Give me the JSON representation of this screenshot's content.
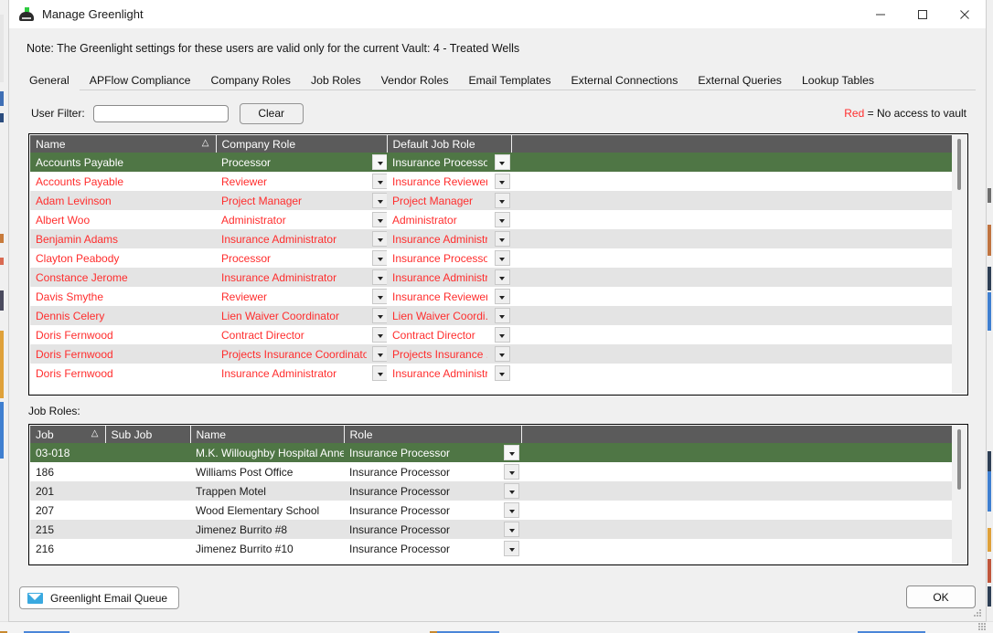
{
  "window": {
    "title": "Manage Greenlight",
    "icon": "greenlight-app-icon",
    "minimize": "—",
    "maximize": "□",
    "close": "✕"
  },
  "note": "Note:  The Greenlight settings for these users are valid only for the current Vault: 4 - Treated Wells",
  "tabs": [
    {
      "label": "General",
      "active": true
    },
    {
      "label": "APFlow Compliance",
      "active": false
    },
    {
      "label": "Company Roles",
      "active": false
    },
    {
      "label": "Job Roles",
      "active": false
    },
    {
      "label": "Vendor Roles",
      "active": false
    },
    {
      "label": "Email Templates",
      "active": false
    },
    {
      "label": "External Connections",
      "active": false
    },
    {
      "label": "External Queries",
      "active": false
    },
    {
      "label": "Lookup Tables",
      "active": false
    }
  ],
  "filter": {
    "label": "User Filter:",
    "value": "",
    "placeholder": "",
    "clear_label": "Clear"
  },
  "legend": {
    "keyword": "Red",
    "text": "= No access to vault",
    "color": "#ff2d2d"
  },
  "users_grid": {
    "columns": [
      {
        "label": "Name",
        "sort": "△"
      },
      {
        "label": "Company Role",
        "sort": ""
      },
      {
        "label": "Default Job Role",
        "sort": ""
      },
      {
        "label": "",
        "sort": ""
      }
    ],
    "rows": [
      {
        "name": "Accounts Payable",
        "company_role": "Processor",
        "default_job_role": "Insurance Processor",
        "selected": true,
        "no_access": false
      },
      {
        "name": "Accounts Payable",
        "company_role": "Reviewer",
        "default_job_role": "Insurance Reviewer",
        "selected": false,
        "no_access": true
      },
      {
        "name": "Adam Levinson",
        "company_role": "Project Manager",
        "default_job_role": "Project Manager",
        "selected": false,
        "no_access": true
      },
      {
        "name": "Albert Woo",
        "company_role": "Administrator",
        "default_job_role": "Administrator",
        "selected": false,
        "no_access": true
      },
      {
        "name": "Benjamin Adams",
        "company_role": "Insurance Administrator",
        "default_job_role": "Insurance Administr...",
        "selected": false,
        "no_access": true
      },
      {
        "name": "Clayton Peabody",
        "company_role": "Processor",
        "default_job_role": "Insurance Processor",
        "selected": false,
        "no_access": true
      },
      {
        "name": "Constance Jerome",
        "company_role": "Insurance Administrator",
        "default_job_role": "Insurance Administr...",
        "selected": false,
        "no_access": true
      },
      {
        "name": "Davis Smythe",
        "company_role": "Reviewer",
        "default_job_role": "Insurance Reviewer",
        "selected": false,
        "no_access": true
      },
      {
        "name": "Dennis Celery",
        "company_role": "Lien Waiver Coordinator",
        "default_job_role": "Lien Waiver Coordi...",
        "selected": false,
        "no_access": true
      },
      {
        "name": "Doris Fernwood",
        "company_role": "Contract Director",
        "default_job_role": "Contract Director",
        "selected": false,
        "no_access": true
      },
      {
        "name": "Doris Fernwood",
        "company_role": "Projects Insurance Coordinator",
        "default_job_role": "Projects Insurance ...",
        "selected": false,
        "no_access": true
      },
      {
        "name": "Doris Fernwood",
        "company_role": "Insurance Administrator",
        "default_job_role": "Insurance Administr...",
        "selected": false,
        "no_access": true
      }
    ],
    "scroll_thumb_top_pct": 2,
    "scroll_thumb_height_pct": 20
  },
  "jobs_section_label": "Job Roles:",
  "jobs_grid": {
    "columns": [
      {
        "label": "Job",
        "sort": "△"
      },
      {
        "label": "Sub Job",
        "sort": ""
      },
      {
        "label": "Name",
        "sort": ""
      },
      {
        "label": "Role",
        "sort": ""
      },
      {
        "label": "",
        "sort": ""
      }
    ],
    "rows": [
      {
        "job": "03-018",
        "sub_job": "",
        "name": "M.K. Willoughby Hospital Annex",
        "role": "Insurance Processor",
        "selected": true
      },
      {
        "job": "186",
        "sub_job": "",
        "name": "Williams Post Office",
        "role": "Insurance Processor",
        "selected": false
      },
      {
        "job": "201",
        "sub_job": "",
        "name": "Trappen Motel",
        "role": "Insurance Processor",
        "selected": false
      },
      {
        "job": "207",
        "sub_job": "",
        "name": "Wood Elementary School",
        "role": "Insurance Processor",
        "selected": false
      },
      {
        "job": "215",
        "sub_job": "",
        "name": "Jimenez Burrito #8",
        "role": "Insurance Processor",
        "selected": false
      },
      {
        "job": "216",
        "sub_job": "",
        "name": "Jimenez Burrito #10",
        "role": "Insurance Processor",
        "selected": false
      }
    ],
    "scroll_thumb_top_pct": 3,
    "scroll_thumb_height_pct": 45
  },
  "footer": {
    "email_queue_label": "Greenlight Email Queue",
    "email_queue_icon": "envelope-icon",
    "ok_label": "OK"
  },
  "colors": {
    "selection_green": "#4f7645",
    "header_gray": "#5b5b5b",
    "no_access_red": "#ff2d2d",
    "window_bg": "#f0f0f0"
  }
}
